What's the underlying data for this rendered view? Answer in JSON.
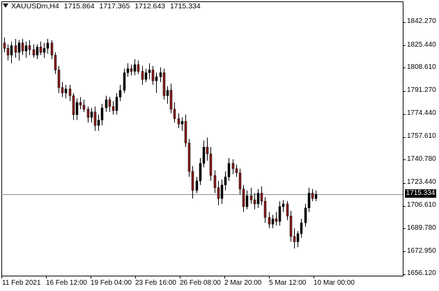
{
  "header": {
    "symbol": "XAUUSDm,H4",
    "ohlc": [
      "1715.864",
      "1717.365",
      "1712.643",
      "1715.334"
    ]
  },
  "price_badge": "1715.334",
  "y_axis": {
    "labels": [
      "1842.270",
      "1825.440",
      "1808.610",
      "1791.270",
      "1774.440",
      "1757.610",
      "1740.780",
      "1723.440",
      "1706.610",
      "1689.780",
      "1672.950",
      "1656.120"
    ]
  },
  "x_axis": {
    "labels": [
      "11 Feb 2021",
      "16 Feb 12:00",
      "19 Feb 04:00",
      "23 Feb 16:00",
      "26 Feb 08:00",
      "2 Mar 20:00",
      "5 Mar 12:00",
      "10 Mar 00:00"
    ]
  },
  "colors": {
    "bull": "#000000",
    "bear": "#8b1a1a",
    "bid_line": "#7f8f9f",
    "frame": "#000000"
  },
  "chart_data": {
    "type": "candlestick",
    "symbol": "XAUUSDm",
    "timeframe": "H4",
    "last_price": 1715.334,
    "ylim": [
      1656.12,
      1850.0
    ],
    "candles": [
      [
        1827,
        1831,
        1820,
        1823
      ],
      [
        1823,
        1826,
        1814,
        1818
      ],
      [
        1818,
        1828,
        1812,
        1825
      ],
      [
        1825,
        1830,
        1816,
        1820
      ],
      [
        1820,
        1829,
        1814,
        1827
      ],
      [
        1827,
        1830,
        1818,
        1821
      ],
      [
        1821,
        1828,
        1816,
        1825
      ],
      [
        1825,
        1829,
        1818,
        1822
      ],
      [
        1822,
        1826,
        1816,
        1818
      ],
      [
        1818,
        1826,
        1815,
        1824
      ],
      [
        1824,
        1828,
        1818,
        1820
      ],
      [
        1820,
        1827,
        1816,
        1823
      ],
      [
        1823,
        1830,
        1819,
        1827
      ],
      [
        1827,
        1829,
        1815,
        1818
      ],
      [
        1818,
        1820,
        1804,
        1807
      ],
      [
        1807,
        1810,
        1790,
        1794
      ],
      [
        1794,
        1798,
        1787,
        1790
      ],
      [
        1790,
        1796,
        1786,
        1793
      ],
      [
        1793,
        1796,
        1784,
        1788
      ],
      [
        1788,
        1790,
        1770,
        1774
      ],
      [
        1774,
        1786,
        1770,
        1783
      ],
      [
        1783,
        1787,
        1778,
        1781
      ],
      [
        1781,
        1785,
        1776,
        1778
      ],
      [
        1778,
        1780,
        1768,
        1772
      ],
      [
        1772,
        1779,
        1768,
        1776
      ],
      [
        1776,
        1780,
        1762,
        1766
      ],
      [
        1766,
        1774,
        1762,
        1770
      ],
      [
        1770,
        1782,
        1766,
        1779
      ],
      [
        1779,
        1788,
        1776,
        1785
      ],
      [
        1785,
        1787,
        1776,
        1780
      ],
      [
        1780,
        1784,
        1774,
        1777
      ],
      [
        1777,
        1790,
        1774,
        1787
      ],
      [
        1787,
        1796,
        1784,
        1792
      ],
      [
        1792,
        1808,
        1790,
        1805
      ],
      [
        1805,
        1812,
        1802,
        1808
      ],
      [
        1808,
        1811,
        1803,
        1806
      ],
      [
        1806,
        1815,
        1803,
        1811
      ],
      [
        1811,
        1814,
        1804,
        1806
      ],
      [
        1806,
        1810,
        1796,
        1800
      ],
      [
        1800,
        1808,
        1798,
        1805
      ],
      [
        1805,
        1812,
        1800,
        1807
      ],
      [
        1807,
        1810,
        1796,
        1799
      ],
      [
        1799,
        1805,
        1790,
        1802
      ],
      [
        1802,
        1809,
        1798,
        1805
      ],
      [
        1805,
        1808,
        1785,
        1788
      ],
      [
        1788,
        1795,
        1782,
        1792
      ],
      [
        1792,
        1797,
        1775,
        1778
      ],
      [
        1778,
        1783,
        1768,
        1771
      ],
      [
        1771,
        1775,
        1764,
        1767
      ],
      [
        1767,
        1772,
        1762,
        1769
      ],
      [
        1769,
        1774,
        1750,
        1753
      ],
      [
        1753,
        1756,
        1728,
        1732
      ],
      [
        1732,
        1736,
        1712,
        1718
      ],
      [
        1718,
        1728,
        1716,
        1725
      ],
      [
        1725,
        1742,
        1722,
        1738
      ],
      [
        1738,
        1755,
        1735,
        1750
      ],
      [
        1750,
        1757,
        1740,
        1745
      ],
      [
        1745,
        1750,
        1725,
        1729
      ],
      [
        1729,
        1733,
        1716,
        1720
      ],
      [
        1720,
        1725,
        1707,
        1712
      ],
      [
        1712,
        1726,
        1708,
        1722
      ],
      [
        1722,
        1732,
        1718,
        1728
      ],
      [
        1728,
        1742,
        1725,
        1738
      ],
      [
        1738,
        1741,
        1730,
        1734
      ],
      [
        1734,
        1737,
        1728,
        1731
      ],
      [
        1731,
        1734,
        1715,
        1719
      ],
      [
        1719,
        1722,
        1702,
        1706
      ],
      [
        1706,
        1718,
        1704,
        1714
      ],
      [
        1714,
        1720,
        1708,
        1711
      ],
      [
        1711,
        1716,
        1704,
        1708
      ],
      [
        1708,
        1719,
        1705,
        1716
      ],
      [
        1716,
        1721,
        1707,
        1710
      ],
      [
        1710,
        1713,
        1694,
        1698
      ],
      [
        1698,
        1702,
        1690,
        1693
      ],
      [
        1693,
        1700,
        1690,
        1697
      ],
      [
        1697,
        1702,
        1692,
        1695
      ],
      [
        1695,
        1710,
        1692,
        1706
      ],
      [
        1706,
        1711,
        1702,
        1708
      ],
      [
        1708,
        1710,
        1696,
        1699
      ],
      [
        1699,
        1703,
        1680,
        1684
      ],
      [
        1684,
        1690,
        1675,
        1680
      ],
      [
        1680,
        1688,
        1676,
        1686
      ],
      [
        1686,
        1697,
        1683,
        1694
      ],
      [
        1694,
        1708,
        1691,
        1705
      ],
      [
        1705,
        1720,
        1702,
        1716
      ],
      [
        1716,
        1719,
        1710,
        1712
      ],
      [
        1712,
        1718,
        1710,
        1715
      ]
    ]
  }
}
